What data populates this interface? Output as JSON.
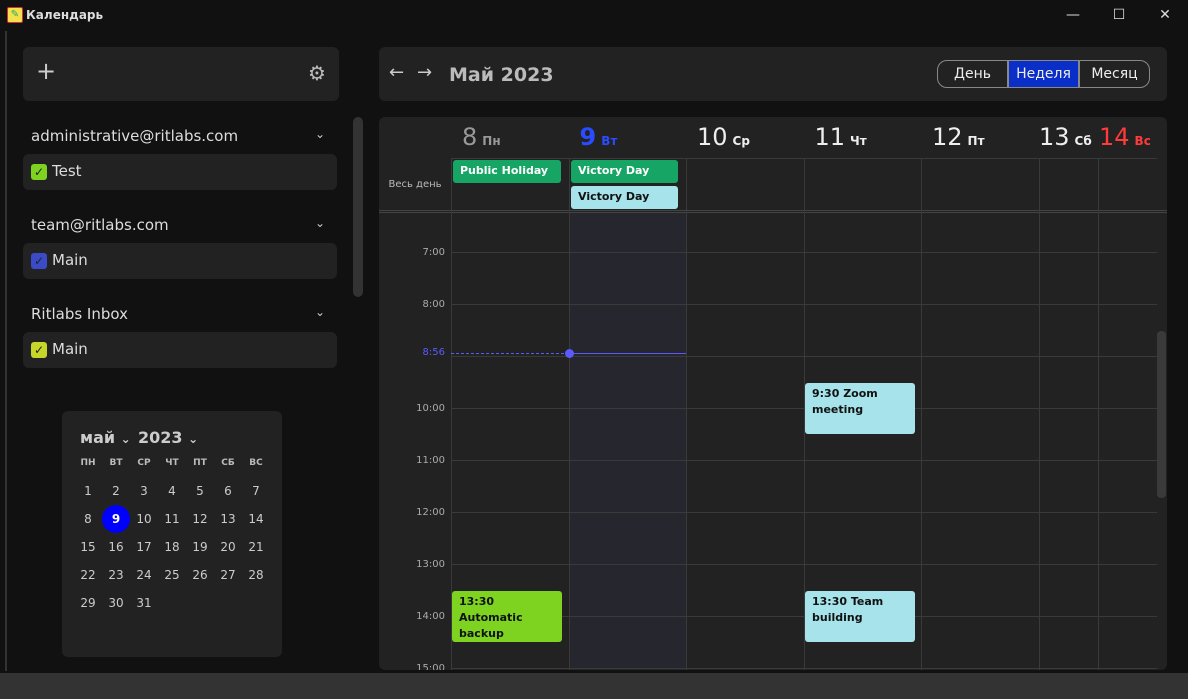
{
  "window": {
    "title": "Календарь",
    "minimize": "—",
    "maximize": "☐",
    "close": "✕"
  },
  "sidebar": {
    "add_label": "+",
    "settings_icon": "gear-icon",
    "groups": [
      {
        "account": "administrative@ritlabs.com",
        "calendars": [
          {
            "label": "Test",
            "color": "#7ed321"
          }
        ]
      },
      {
        "account": "team@ritlabs.com",
        "calendars": [
          {
            "label": "Main",
            "color": "#3b4bc8"
          }
        ]
      },
      {
        "account": "Ritlabs Inbox",
        "calendars": [
          {
            "label": "Main",
            "color": "#c8d62a"
          }
        ]
      }
    ],
    "mini_calendar": {
      "month": "май",
      "year": "2023",
      "weekdays": [
        "ПН",
        "ВТ",
        "СР",
        "ЧТ",
        "ПТ",
        "СБ",
        "ВС"
      ],
      "days": 31,
      "first_weekday_index": 0,
      "selected": 9
    }
  },
  "header": {
    "title": "Май 2023",
    "views": [
      "День",
      "Неделя",
      "Месяц"
    ],
    "active_view": "Неделя",
    "accent": "#0a2ec8"
  },
  "week": {
    "days": [
      {
        "num": "8",
        "dow": "Пн",
        "color": "#999"
      },
      {
        "num": "9",
        "dow": "Вт",
        "color": "#2a4cff"
      },
      {
        "num": "10",
        "dow": "Ср",
        "color": "#eee"
      },
      {
        "num": "11",
        "dow": "Чт",
        "color": "#eee"
      },
      {
        "num": "12",
        "dow": "Пт",
        "color": "#eee"
      },
      {
        "num": "13",
        "dow": "Сб",
        "color": "#eee"
      },
      {
        "num": "14",
        "dow": "Вс",
        "color": "#ff3b3b"
      }
    ],
    "allday_label": "Весь день",
    "allday_events": [
      {
        "title": "Public Holiday",
        "day": 0,
        "row": 0,
        "color": "#17a566",
        "text": "#fff"
      },
      {
        "title": "Victory Day",
        "day": 1,
        "row": 0,
        "color": "#17a566",
        "text": "#fff"
      },
      {
        "title": "Victory Day",
        "day": 1,
        "row": 1,
        "color": "#a6e3ea",
        "text": "#111"
      }
    ],
    "hours": [
      "7:00",
      "8:00",
      "9:00",
      "10:00",
      "11:00",
      "12:00",
      "13:00",
      "14:00",
      "15:00"
    ],
    "now": {
      "label": "8:56",
      "hour": 8.933,
      "color": "#5a5aff"
    },
    "events": [
      {
        "title": "9:30 Zoom meeting",
        "day": 3,
        "start": 9.5,
        "end": 10.5,
        "color": "#a6e3ea"
      },
      {
        "title": "13:30 Automatic backup",
        "day": 0,
        "start": 13.5,
        "end": 14.5,
        "color": "#7ed321"
      },
      {
        "title": "13:30 Team building",
        "day": 3,
        "start": 13.5,
        "end": 14.5,
        "color": "#a6e3ea"
      }
    ]
  }
}
